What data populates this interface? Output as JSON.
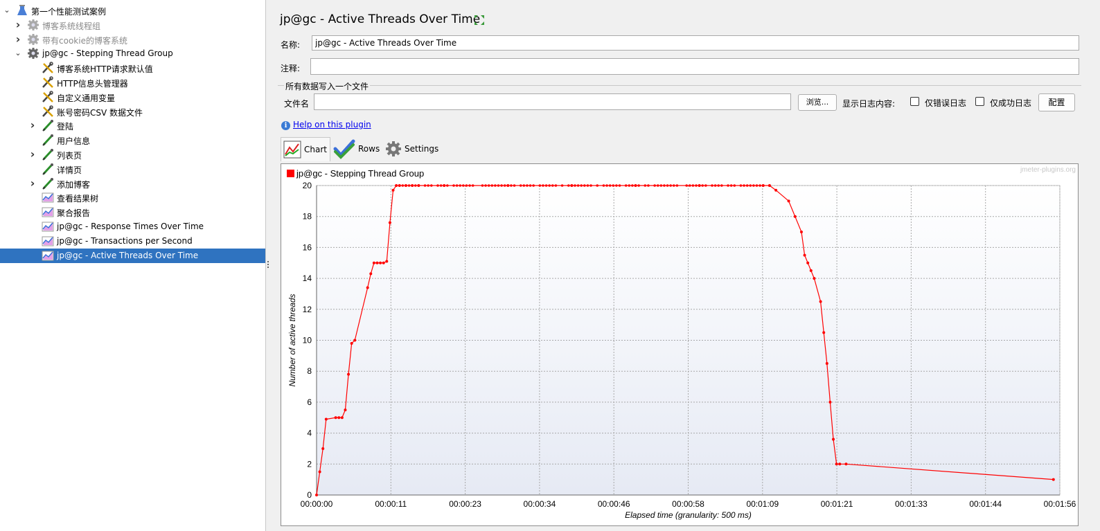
{
  "tree": {
    "nodes": [
      {
        "label": "第一个性能测试案例",
        "level": 0,
        "arrow": "down",
        "icon": "test-plan-icon",
        "disabled": false,
        "selected": false
      },
      {
        "label": "博客系统线程组",
        "level": 1,
        "arrow": "right",
        "icon": "thread-group-icon",
        "disabled": true,
        "selected": false
      },
      {
        "label": "带有cookie的博客系统",
        "level": 1,
        "arrow": "right",
        "icon": "thread-group-icon",
        "disabled": true,
        "selected": false
      },
      {
        "label": "jp@gc - Stepping Thread Group",
        "level": 1,
        "arrow": "down",
        "icon": "thread-group-icon",
        "disabled": false,
        "selected": false
      },
      {
        "label": "博客系统HTTP请求默认值",
        "level": 2,
        "arrow": "",
        "icon": "config-element-icon",
        "disabled": false,
        "selected": false
      },
      {
        "label": "HTTP信息头管理器",
        "level": 2,
        "arrow": "",
        "icon": "config-element-icon",
        "disabled": false,
        "selected": false
      },
      {
        "label": "自定义通用变量",
        "level": 2,
        "arrow": "",
        "icon": "config-element-icon",
        "disabled": false,
        "selected": false
      },
      {
        "label": "账号密码CSV 数据文件",
        "level": 2,
        "arrow": "",
        "icon": "config-element-icon",
        "disabled": false,
        "selected": false
      },
      {
        "label": "登陆",
        "level": 2,
        "arrow": "right",
        "icon": "sampler-icon",
        "disabled": false,
        "selected": false
      },
      {
        "label": "用户信息",
        "level": 2,
        "arrow": "",
        "icon": "sampler-icon",
        "disabled": false,
        "selected": false
      },
      {
        "label": "列表页",
        "level": 2,
        "arrow": "right",
        "icon": "sampler-icon",
        "disabled": false,
        "selected": false
      },
      {
        "label": "详情页",
        "level": 2,
        "arrow": "",
        "icon": "sampler-icon",
        "disabled": false,
        "selected": false
      },
      {
        "label": "添加博客",
        "level": 2,
        "arrow": "right",
        "icon": "sampler-icon",
        "disabled": false,
        "selected": false
      },
      {
        "label": "查看结果树",
        "level": 2,
        "arrow": "",
        "icon": "listener-icon",
        "disabled": false,
        "selected": false
      },
      {
        "label": "聚合报告",
        "level": 2,
        "arrow": "",
        "icon": "listener-icon",
        "disabled": false,
        "selected": false
      },
      {
        "label": "jp@gc - Response Times Over Time",
        "level": 2,
        "arrow": "",
        "icon": "listener-icon",
        "disabled": false,
        "selected": false
      },
      {
        "label": "jp@gc - Transactions per Second",
        "level": 2,
        "arrow": "",
        "icon": "listener-icon",
        "disabled": false,
        "selected": false
      },
      {
        "label": "jp@gc - Active Threads Over Time",
        "level": 2,
        "arrow": "",
        "icon": "listener-icon",
        "disabled": false,
        "selected": true
      }
    ]
  },
  "panel": {
    "title": "jp@gc - Active Threads Over Time",
    "name_label": "名称:",
    "name_value": "jp@gc - Active Threads Over Time",
    "comment_label": "注释:",
    "comment_value": "",
    "file_group_legend": "所有数据写入一个文件",
    "filename_label": "文件名",
    "filename_value": "",
    "browse_label": "浏览...",
    "log_label": "显示日志内容:",
    "errors_only_label": "仅错误日志",
    "errors_only_checked": false,
    "success_only_label": "仅成功日志",
    "success_only_checked": false,
    "configure_label": "配置",
    "help_link": "Help on this plugin",
    "tabs": [
      {
        "label": "Chart",
        "icon": "chart-icon",
        "active": true
      },
      {
        "label": "Rows",
        "icon": "checkmark-icon",
        "active": false
      },
      {
        "label": "Settings",
        "icon": "gear-icon",
        "active": false
      }
    ]
  },
  "colors": {
    "selection": "#2f73c0",
    "series": "#ff0000",
    "plot_bg_top": "#ffffff",
    "plot_bg_bottom": "#e6eaf4"
  },
  "chart_data": {
    "type": "line",
    "watermark": "jmeter-plugins.org",
    "xlabel": "Elapsed time (granularity: 500 ms)",
    "ylabel": "Number of active threads",
    "xlim": [
      "00:00:00",
      "00:01:56"
    ],
    "ylim": [
      0,
      20
    ],
    "yticks": [
      0,
      2,
      4,
      6,
      8,
      10,
      12,
      14,
      16,
      18,
      20
    ],
    "xticks": [
      "00:00:00",
      "00:00:11",
      "00:00:23",
      "00:00:34",
      "00:00:46",
      "00:00:58",
      "00:01:09",
      "00:01:21",
      "00:01:33",
      "00:01:44",
      "00:01:56"
    ],
    "grid": true,
    "legend_position": "top-left",
    "series": [
      {
        "name": "jp@gc - Stepping Thread Group",
        "x": [
          "00:00:00",
          "00:00:00.5",
          "00:00:01",
          "00:00:01.5",
          "00:00:03",
          "00:00:03.5",
          "00:00:04",
          "00:00:04.5",
          "00:00:05",
          "00:00:05.5",
          "00:00:06",
          "00:00:08",
          "00:00:08.5",
          "00:00:09",
          "00:00:09.5",
          "00:00:10",
          "00:00:10.5",
          "00:00:11",
          "00:00:11.5",
          "00:00:12",
          "00:00:12.5",
          "00:00:13",
          "00:00:14",
          "00:00:15",
          "00:00:16",
          "00:00:20",
          "00:00:30",
          "00:00:40",
          "00:00:50",
          "00:01:00",
          "00:01:10",
          "00:01:11",
          "00:01:12",
          "00:01:14",
          "00:01:15",
          "00:01:16",
          "00:01:16.5",
          "00:01:17",
          "00:01:17.5",
          "00:01:18",
          "00:01:19",
          "00:01:19.5",
          "00:01:20",
          "00:01:20.5",
          "00:01:21",
          "00:01:21.5",
          "00:01:22",
          "00:01:23",
          "00:01:55.5"
        ],
        "values": [
          0,
          1.5,
          3,
          4.9,
          5,
          5,
          5,
          5.5,
          7.8,
          9.8,
          10,
          13.4,
          14.3,
          15,
          15,
          15,
          15,
          15.1,
          17.6,
          19.7,
          20,
          20,
          20,
          20,
          20,
          20,
          20,
          20,
          20,
          20,
          20,
          20,
          19.7,
          19,
          18,
          17,
          15.5,
          15,
          14.5,
          14,
          12.5,
          10.5,
          8.5,
          6,
          3.6,
          2,
          2,
          2,
          1
        ]
      }
    ]
  }
}
